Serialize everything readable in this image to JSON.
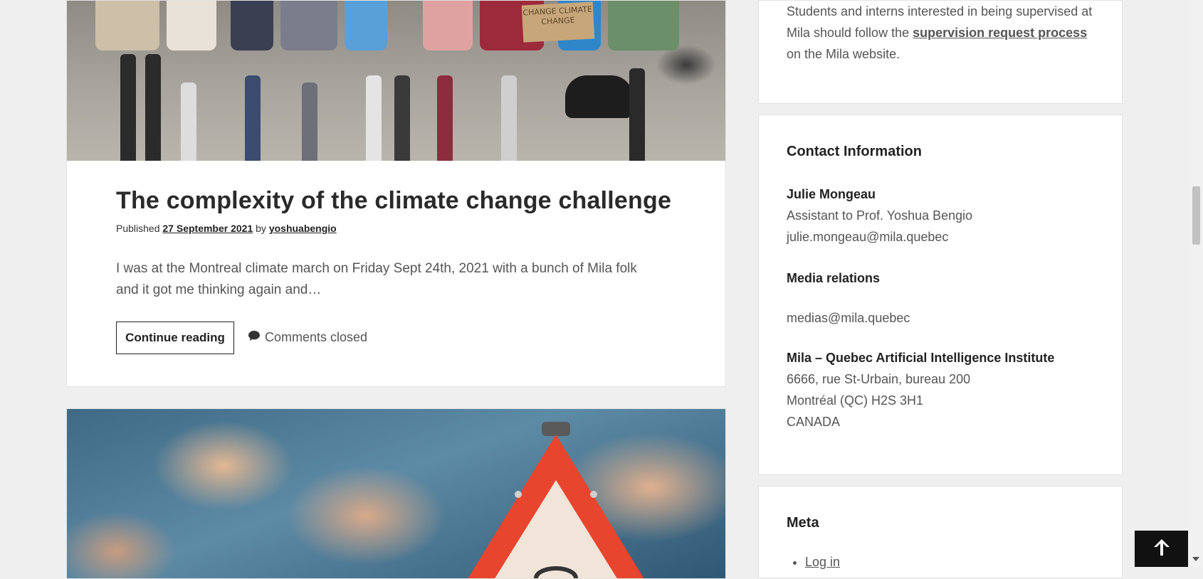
{
  "posts": [
    {
      "title": "The complexity of the climate change challenge",
      "meta_prefix": "Published",
      "date": "27 September 2021",
      "meta_by": "by",
      "author": "yoshuabengio",
      "excerpt": "I was at the Montreal climate march on Friday Sept 24th, 2021 with a bunch of Mila folk and it got me thinking again and…",
      "continue_label": "Continue reading",
      "comments_label": "Comments closed",
      "image_sign_text": "CHANGE CLIMATE CHANGE"
    }
  ],
  "sidebar": {
    "supervision": {
      "text_before": "Students and interns interested in being supervised at Mila should follow the",
      "link_text": "supervision request process",
      "text_after": "on the Mila website."
    },
    "contact": {
      "title": "Contact Information",
      "person_name": "Julie Mongeau",
      "person_role": "Assistant to Prof. Yoshua Bengio",
      "person_email": "julie.mongeau@mila.quebec",
      "media_title": "Media relations",
      "media_email": "medias@mila.quebec",
      "org_name": "Mila – Quebec Artificial Intelligence Institute",
      "address_line1": "6666, rue St-Urbain, bureau 200",
      "address_line2": "Montréal (QC) H2S 3H1",
      "address_line3": "CANADA"
    },
    "meta": {
      "title": "Meta",
      "items": [
        "Log in"
      ]
    }
  },
  "colors": {
    "background": "#efefef",
    "card": "#ffffff",
    "text": "#222222",
    "muted": "#555555",
    "back_to_top": "#111111"
  },
  "icons": {
    "comments": "speech-bubble-icon",
    "back_to_top": "arrow-up-icon"
  }
}
